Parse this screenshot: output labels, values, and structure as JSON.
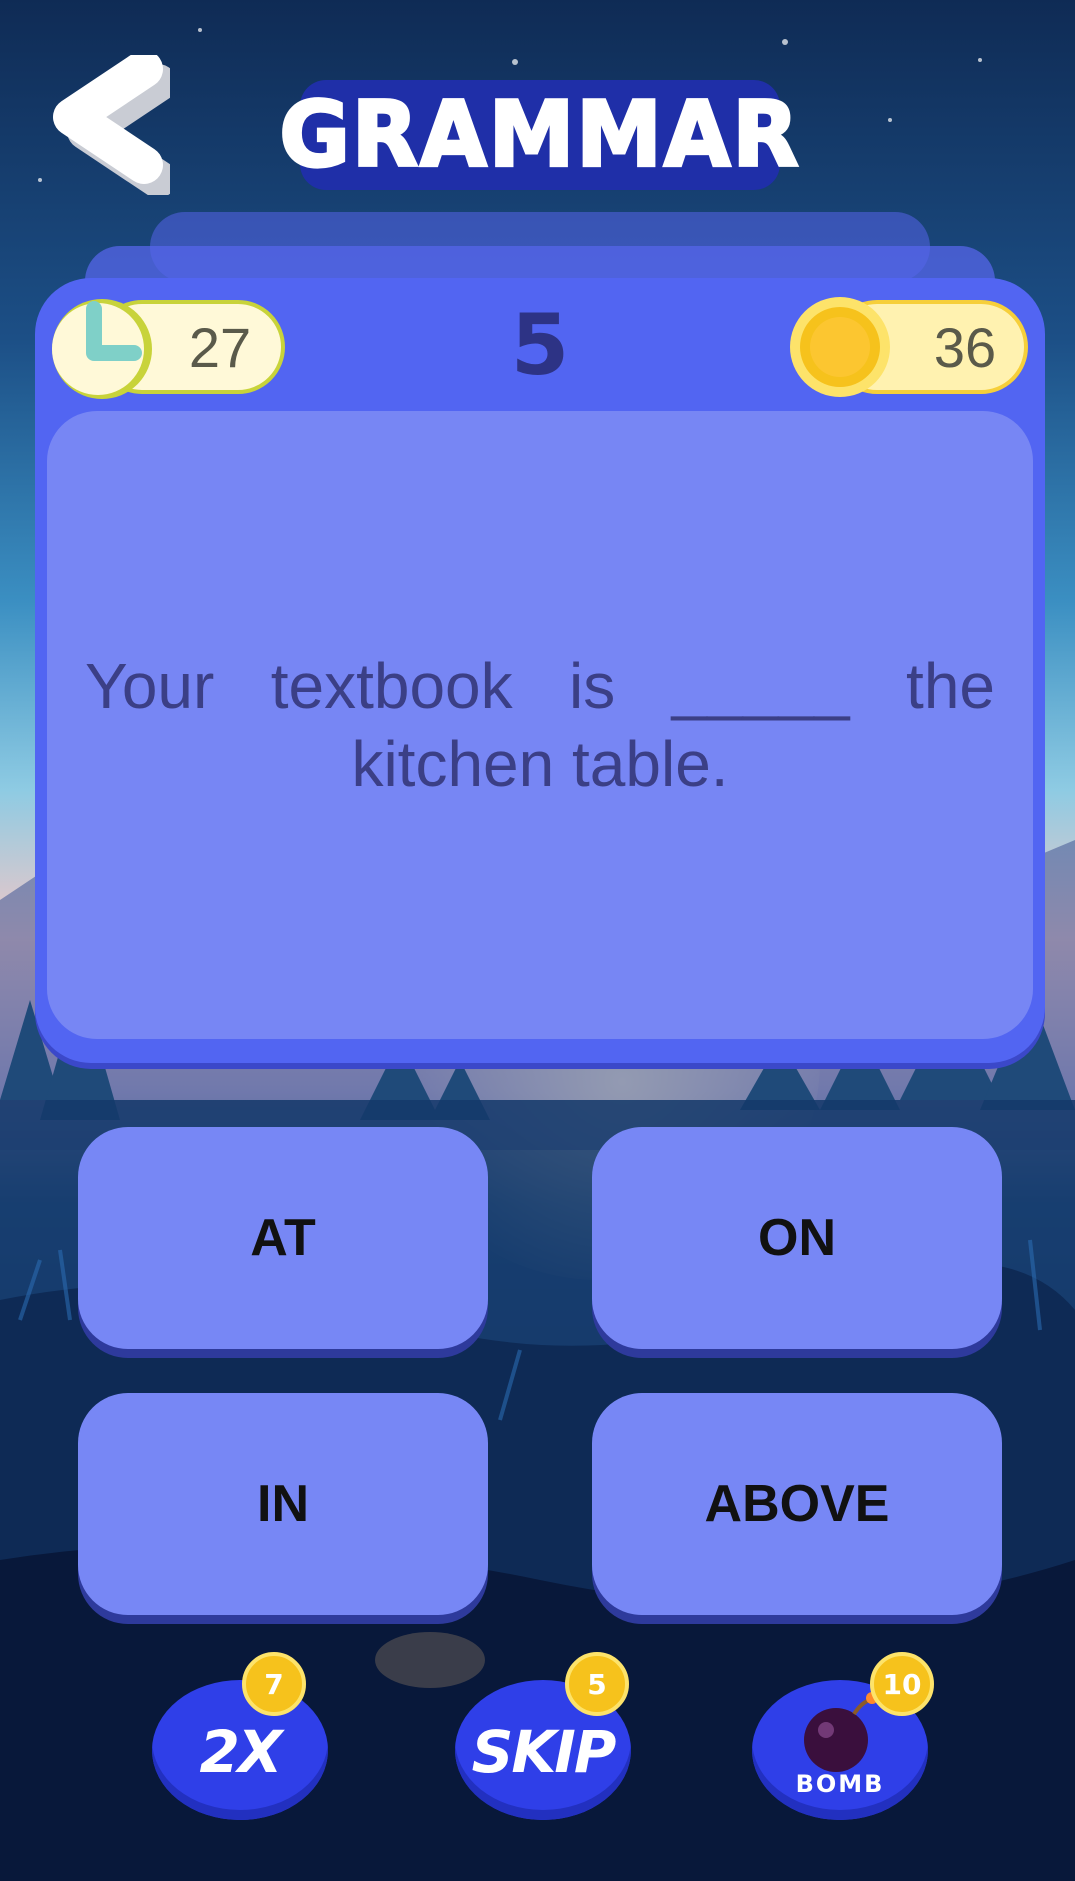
{
  "header": {
    "title": "GRAMMAR"
  },
  "status": {
    "timer": "27",
    "question_number": "5",
    "coins": "36"
  },
  "question": {
    "text": "Your textbook is _____ the kitchen table."
  },
  "answers": [
    {
      "label": "AT"
    },
    {
      "label": "ON"
    },
    {
      "label": "IN"
    },
    {
      "label": "ABOVE"
    }
  ],
  "powerups": [
    {
      "label": "2X",
      "cost": "7"
    },
    {
      "label": "SKIP",
      "cost": "5"
    },
    {
      "label": "BOMB",
      "cost": "10"
    }
  ],
  "colors": {
    "card": "#5265f2",
    "card_inner": "#7786f4",
    "answer": "#7787f5",
    "title_bg": "#1f2fa8",
    "coin": "#f6c21c",
    "timer_accent": "#c8d33a"
  },
  "icons": {
    "back": "back-chevron-icon",
    "timer": "clock-icon",
    "coin": "coin-icon",
    "bomb": "bomb-icon"
  }
}
